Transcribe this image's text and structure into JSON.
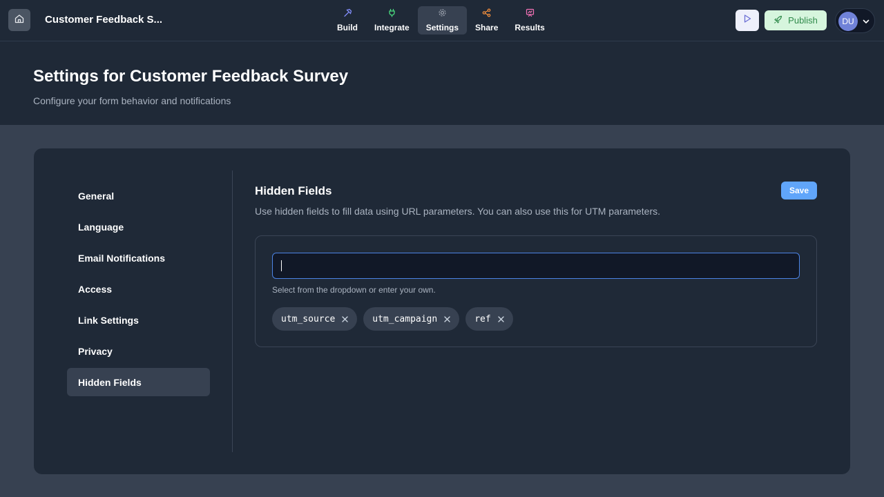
{
  "app": {
    "title": "Customer Feedback S..."
  },
  "nav": {
    "items": [
      {
        "label": "Build",
        "icon": "hammer-icon",
        "color": "#818cf8"
      },
      {
        "label": "Integrate",
        "icon": "plug-icon",
        "color": "#4ade80"
      },
      {
        "label": "Settings",
        "icon": "gear-icon",
        "color": "#9ca3af",
        "active": true
      },
      {
        "label": "Share",
        "icon": "share-icon",
        "color": "#fb923c"
      },
      {
        "label": "Results",
        "icon": "presentation-icon",
        "color": "#f472b6"
      }
    ]
  },
  "actions": {
    "publish_label": "Publish"
  },
  "user": {
    "initials": "DU"
  },
  "header": {
    "title": "Settings for Customer Feedback Survey",
    "subtitle": "Configure your form behavior and notifications"
  },
  "sidebar": {
    "items": [
      {
        "label": "General"
      },
      {
        "label": "Language"
      },
      {
        "label": "Email Notifications"
      },
      {
        "label": "Access"
      },
      {
        "label": "Link Settings"
      },
      {
        "label": "Privacy"
      },
      {
        "label": "Hidden Fields",
        "active": true
      }
    ]
  },
  "section": {
    "title": "Hidden Fields",
    "description": "Use hidden fields to fill data using URL parameters. You can also use this for UTM parameters.",
    "save_label": "Save",
    "input_value": "",
    "helper": "Select from the dropdown or enter your own.",
    "tags": [
      "utm_source",
      "utm_campaign",
      "ref"
    ]
  },
  "colors": {
    "accent": "#60a5fa",
    "publish_bg": "#d6f5dd",
    "publish_text": "#2f8a4a",
    "panel": "#1f2937",
    "page_bg": "#374151"
  }
}
